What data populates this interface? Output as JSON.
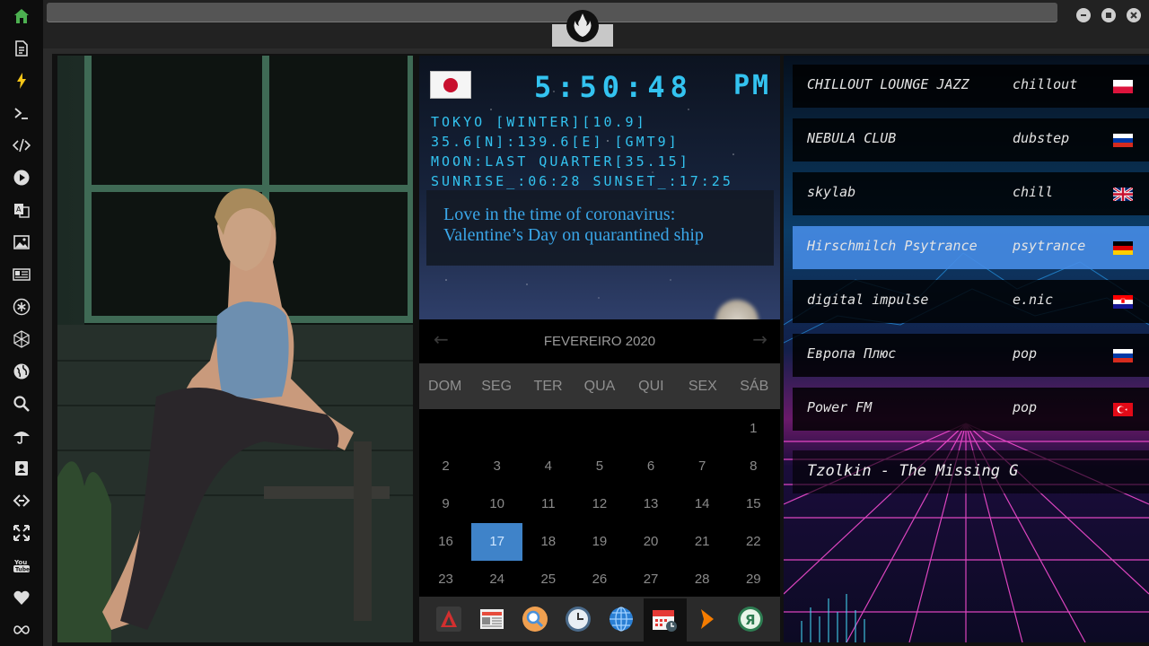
{
  "window": {
    "title": ""
  },
  "sidebar": {
    "items": [
      {
        "icon": "home-icon"
      },
      {
        "icon": "document-icon"
      },
      {
        "icon": "lightning-icon"
      },
      {
        "icon": "terminal-icon"
      },
      {
        "icon": "code-icon"
      },
      {
        "icon": "play-icon"
      },
      {
        "icon": "translate-icon"
      },
      {
        "icon": "image-icon"
      },
      {
        "icon": "news-icon"
      },
      {
        "icon": "asterisk-icon"
      },
      {
        "icon": "hexagon-icon"
      },
      {
        "icon": "globe-icon"
      },
      {
        "icon": "search-icon"
      },
      {
        "icon": "umbrella-icon"
      },
      {
        "icon": "contacts-icon"
      },
      {
        "icon": "link-icon"
      },
      {
        "icon": "fullscreen-icon"
      },
      {
        "icon": "youtube-icon"
      },
      {
        "icon": "heart-icon"
      },
      {
        "icon": "infinity-icon"
      }
    ],
    "active_color": "#4caf50"
  },
  "clock": {
    "time": "5:50:48",
    "ampm": "PM",
    "location": "TOKYO [WINTER][10.9]",
    "coords": "35.6[N]:139.6[E] [GMT9]",
    "moon": "MOON:LAST QUARTER[35.15]",
    "sun": "SUNRISE_:06:28 SUNSET_:17:25",
    "accent": "#33c3f0"
  },
  "news": {
    "line1": "Love in the time of coronavirus:",
    "line2": "Valentine’s Day on quarantined ship"
  },
  "calendar": {
    "title": "FEVEREIRO 2020",
    "prev": "←",
    "next": "→",
    "weekdays": [
      "DOM",
      "SEG",
      "TER",
      "QUA",
      "QUI",
      "SEX",
      "SÁB"
    ],
    "weeks": [
      [
        "",
        "",
        "",
        "",
        "",
        "",
        "1"
      ],
      [
        "2",
        "3",
        "4",
        "5",
        "6",
        "7",
        "8"
      ],
      [
        "9",
        "10",
        "11",
        "12",
        "13",
        "14",
        "15"
      ],
      [
        "16",
        "17",
        "18",
        "19",
        "20",
        "21",
        "22"
      ],
      [
        "23",
        "24",
        "25",
        "26",
        "27",
        "28",
        "29"
      ]
    ],
    "today": "17",
    "today_color": "#3f83c9"
  },
  "dock": {
    "apps": [
      "launcher-icon",
      "news-app-icon",
      "search-app-icon",
      "clock-app-icon",
      "globe-app-icon",
      "calendar-app-icon",
      "arrow-app-icon",
      "yandex-icon"
    ]
  },
  "radio": {
    "stations": [
      {
        "name": "CHILLOUT LOUNGE JAZZ",
        "genre": "chillout",
        "flag": "pl"
      },
      {
        "name": "NEBULA CLUB",
        "genre": "dubstep",
        "flag": "ru"
      },
      {
        "name": "skylab",
        "genre": "chill",
        "flag": "gb"
      },
      {
        "name": "Hirschmilch Psytrance",
        "genre": "psytrance",
        "flag": "de"
      },
      {
        "name": "digital impulse",
        "genre": "e.nic",
        "flag": "hr"
      },
      {
        "name": "Европа Плюс",
        "genre": "pop",
        "flag": "ru"
      },
      {
        "name": "Power FM",
        "genre": "pop",
        "flag": "tr"
      }
    ],
    "active_index": 3,
    "now_playing": "Tzolkin - The Missing G"
  }
}
